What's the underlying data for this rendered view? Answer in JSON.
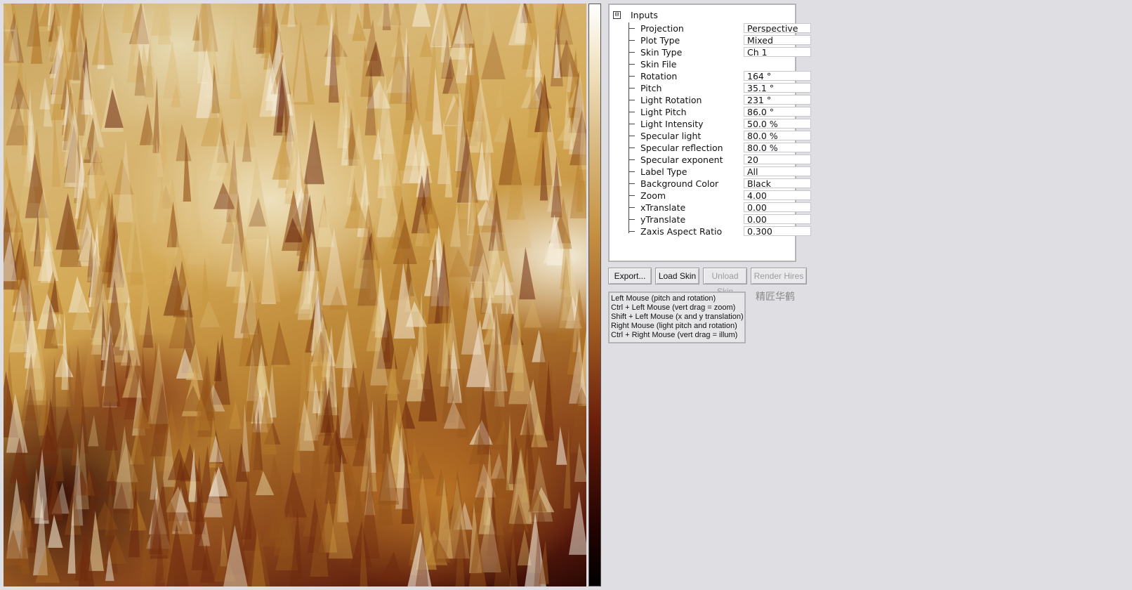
{
  "tree": {
    "root_label": "Inputs",
    "expander_symbol": "⊟",
    "properties": [
      {
        "label": "Projection",
        "value": "Perspective"
      },
      {
        "label": "Plot Type",
        "value": "Mixed"
      },
      {
        "label": "Skin Type",
        "value": "Ch 1"
      },
      {
        "label": "Skin File",
        "value": ""
      },
      {
        "label": "Rotation",
        "value": "164 °"
      },
      {
        "label": "Pitch",
        "value": "35.1 °"
      },
      {
        "label": "Light Rotation",
        "value": "231 °"
      },
      {
        "label": "Light Pitch",
        "value": "86.0 °"
      },
      {
        "label": "Light Intensity",
        "value": "50.0 %"
      },
      {
        "label": "Specular light",
        "value": "80.0 %"
      },
      {
        "label": "Specular reflection",
        "value": "80.0 %"
      },
      {
        "label": "Specular exponent",
        "value": "20"
      },
      {
        "label": "Label Type",
        "value": "All"
      },
      {
        "label": "Background Color",
        "value": "Black"
      },
      {
        "label": "Zoom",
        "value": "4.00"
      },
      {
        "label": "xTranslate",
        "value": "0.00"
      },
      {
        "label": "yTranslate",
        "value": "0.00"
      },
      {
        "label": "Zaxis Aspect Ratio",
        "value": "0.300"
      }
    ]
  },
  "buttons": {
    "export": "Export...",
    "load_skin": "Load Skin",
    "unload_skin": "Unload Skin",
    "render_hires": "Render Hires"
  },
  "help": {
    "lines": [
      "Left Mouse (pitch and rotation)",
      "Ctrl + Left Mouse (vert drag = zoom)",
      "Shift + Left Mouse (x and y translation)",
      "Right Mouse (light pitch and rotation)",
      "Ctrl + Right Mouse (vert drag = illum)"
    ]
  },
  "watermark": "精匠华鹤",
  "colors": {
    "background": "#dfdfe3",
    "surface_light": "#f2e5c6",
    "surface_mid": "#c89546",
    "surface_dark": "#6b1e0a"
  }
}
